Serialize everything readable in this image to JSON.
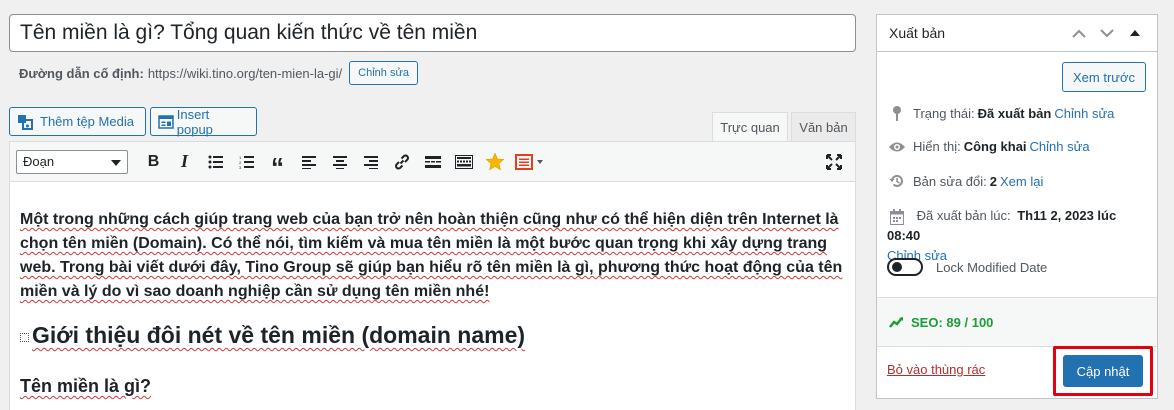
{
  "post": {
    "title": "Tên miền là gì? Tổng quan kiến thức về tên miền",
    "permalink_label": "Đường dẫn cố định:",
    "permalink_url": "https://wiki.tino.org/ten-mien-la-gi/",
    "permalink_edit": "Chỉnh sửa"
  },
  "media": {
    "add_media": "Thêm tệp Media",
    "insert_popup": "Insert popup"
  },
  "tabs": {
    "visual": "Trực quan",
    "text": "Văn bản"
  },
  "toolbar": {
    "format_value": "Đoạn",
    "icons": [
      "bold-icon",
      "italic-icon",
      "bullet-list-icon",
      "numbered-list-icon",
      "blockquote-icon",
      "align-left-icon",
      "align-center-icon",
      "align-right-icon",
      "link-icon",
      "read-more-icon",
      "toolbar-toggle-icon",
      "star-icon",
      "shortcode-icon",
      "fullscreen-icon"
    ]
  },
  "content": {
    "paragraph": "Một trong những cách giúp trang web của bạn trở nên hoàn thiện cũng như có thể hiện diện trên Internet là chọn tên miền (Domain). Có thể nói, tìm kiếm và mua tên miền là một bước quan trọng khi xây dựng trang web. Trong bài viết dưới đây, Tino Group sẽ giúp bạn hiểu rõ tên miền là gì, phương thức hoạt động của tên miền và lý do vì sao doanh nghiệp cần sử dụng tên miền nhé!",
    "heading2": "Giới thiệu đôi nét về tên miền (domain name)",
    "heading3": "Tên miền là gì?"
  },
  "publish": {
    "title": "Xuất bản",
    "preview": "Xem trước",
    "status_label": "Trạng thái:",
    "status_value": "Đã xuất bản",
    "status_edit": "Chỉnh sửa",
    "visibility_label": "Hiển thị:",
    "visibility_value": "Công khai",
    "visibility_edit": "Chỉnh sửa",
    "revisions_label": "Bản sửa đổi:",
    "revisions_value": "2",
    "revisions_link": "Xem lại",
    "published_label": "Đã xuất bản lúc:",
    "published_value": "Th11 2, 2023 lúc 08:40",
    "published_edit": "Chỉnh sửa",
    "lock_label": "Lock Modified Date",
    "seo_label": "SEO:",
    "seo_value": "89 / 100",
    "trash": "Bỏ vào thùng rác",
    "update": "Cập nhật"
  },
  "colors": {
    "accent": "#2271b1",
    "seo_green": "#1a9e35",
    "trash_red": "#b32d2e",
    "highlight_red": "#e3000f"
  }
}
